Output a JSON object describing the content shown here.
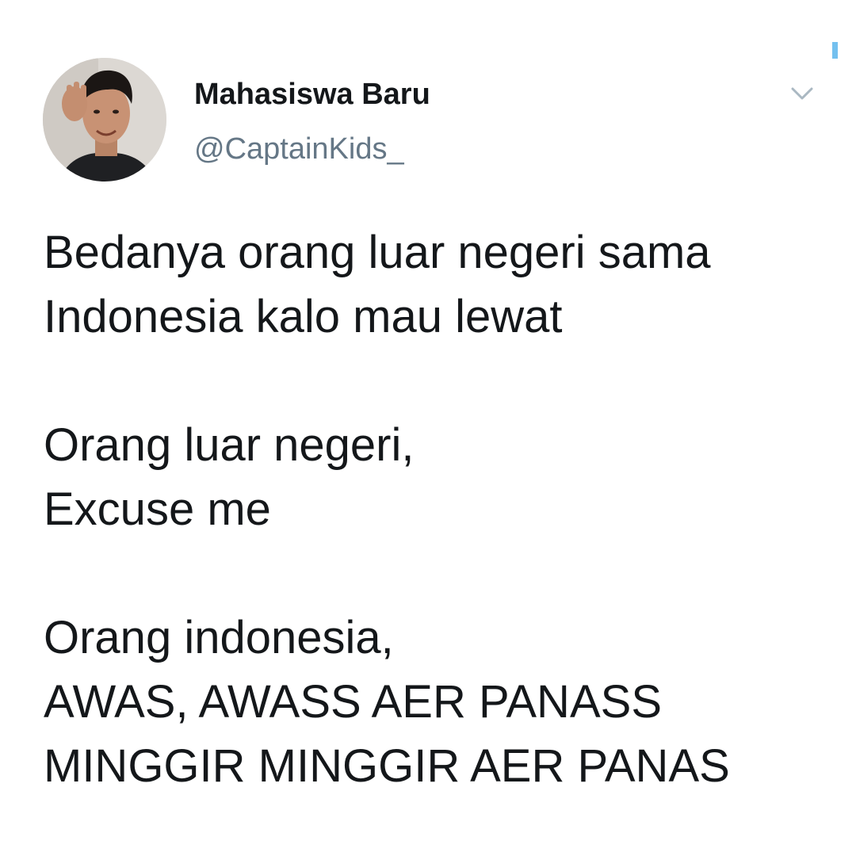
{
  "user": {
    "display_name": "Mahasiswa Baru",
    "handle": "@CaptainKids_"
  },
  "menu": {
    "caret_icon": "chevron-down-icon"
  },
  "tweet": {
    "paragraphs": [
      [
        "Bedanya orang luar negeri sama",
        "Indonesia kalo mau lewat"
      ],
      [
        "Orang luar negeri,",
        "Excuse me"
      ],
      [
        "Orang indonesia,",
        "AWAS, AWASS AER PANASS",
        "MINGGIR MINGGIR AER PANAS"
      ]
    ]
  },
  "colors": {
    "text": "#14171a",
    "handle": "#657786",
    "caret": "#aab8c2",
    "accent": "#1da1f2"
  }
}
